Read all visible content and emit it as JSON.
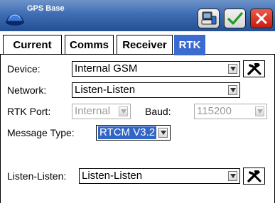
{
  "window": {
    "title": "GPS Base"
  },
  "icons": {
    "app": "gps-helmet-icon",
    "device": "device-config-icon",
    "ok": "checkmark-icon",
    "close": "close-x-icon",
    "tools": "tools-icon",
    "dropdown": "dropdown-arrow-icon"
  },
  "colors": {
    "titlebar": "#3f6db3",
    "active_tab": "#3b6bd0",
    "ok_green": "#1f9a1f",
    "close_red": "#d42415",
    "selection": "#3166c6"
  },
  "tabs": [
    {
      "label": "Current",
      "active": false
    },
    {
      "label": "Comms",
      "active": false
    },
    {
      "label": "Receiver",
      "active": false
    },
    {
      "label": "RTK",
      "active": true
    }
  ],
  "form": {
    "device": {
      "label": "Device:",
      "value": "Internal GSM"
    },
    "network": {
      "label": "Network:",
      "value": "Listen-Listen"
    },
    "rtk_port": {
      "label": "RTK Port:",
      "value": "Internal",
      "disabled": true
    },
    "baud": {
      "label": "Baud:",
      "value": "115200",
      "disabled": true
    },
    "message_type": {
      "label": "Message Type:",
      "value": "RTCM V3.2"
    },
    "listen": {
      "label": "Listen-Listen:",
      "value": "Listen-Listen"
    }
  }
}
